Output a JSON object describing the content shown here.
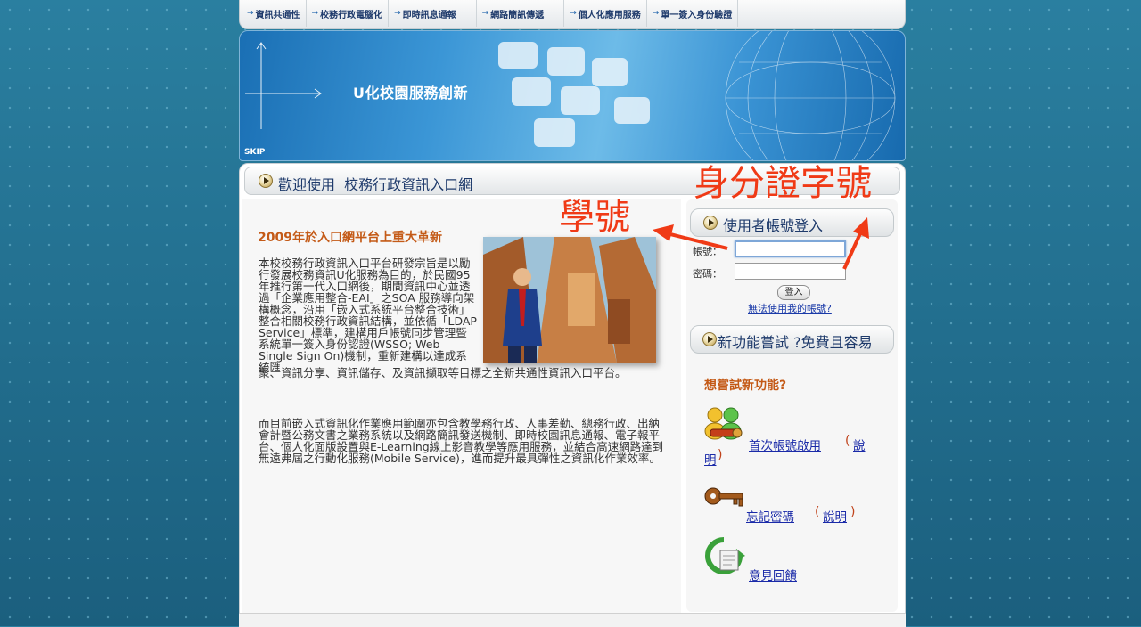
{
  "nav": {
    "items": [
      {
        "label": "資訊共通性"
      },
      {
        "label": "校務行政電腦化"
      },
      {
        "label": "即時訊息通報"
      },
      {
        "label": "網路簡訊傳遞"
      },
      {
        "label": "個人化應用服務"
      },
      {
        "label": "單一簽入身份驗證"
      }
    ]
  },
  "banner": {
    "title": "U化校園服務創新",
    "skip": "SKIP"
  },
  "welcome": {
    "text": "歡迎使用  校務行政資訊入口網"
  },
  "article": {
    "headline": "2009年於入口網平台上重大革新",
    "para1a": "本校校務行政資訊入口平台研發宗旨是以勵行發展校務資訊U化服務為目的，於民國95年推行第一代入口網後，期間資訊中心並透過「企業應用整合-EAI」之SOA 服務導向架構概念，沿用「嵌入式系統平台整合技術」整合相關校務行政資訊結構，並依循「LDAP Service」標準，建構用戶帳號同步管理暨系統單一簽入身份認證(WSSO; Web Single Sign On)機制，重新建構以達成系統匯",
    "para1b": "聚、資訊分享、資訊儲存、及資訊擷取等目標之全新共通性資訊入口平台。",
    "para2": "而目前嵌入式資訊化作業應用範圍亦包含教學務行政、人事差勤、總務行政、出納會計暨公務文書之業務系統以及網路簡訊發送機制、即時校園訊息通報、電子報平台、個人化面版設置與E-Learning線上影音教學等應用服務，並結合高速網路達到無遠弗屆之行動化服務(Mobile Service)，進而提升最具彈性之資訊化作業效率。"
  },
  "login": {
    "heading": "使用者帳號登入",
    "account_label": "帳號：",
    "password_label": "密碼：",
    "account_value": "",
    "password_value": "",
    "submit_label": "登入",
    "cant_use_link": "無法使用我的帳號?"
  },
  "new_features": {
    "heading": "新功能嘗試 ?免費且容易",
    "try_heading": "想嘗試新功能?",
    "first_activation": "首次帳號啟用",
    "first_help_a": "說",
    "first_help_b": "明",
    "forgot_password": "忘記密碼",
    "forgot_help": "說明",
    "feedback": "意見回饋",
    "bracket_open": "(",
    "bracket_close": ")"
  },
  "annotations": {
    "student_id": "學號",
    "national_id": "身分證字號",
    "color": "#f03a16"
  }
}
